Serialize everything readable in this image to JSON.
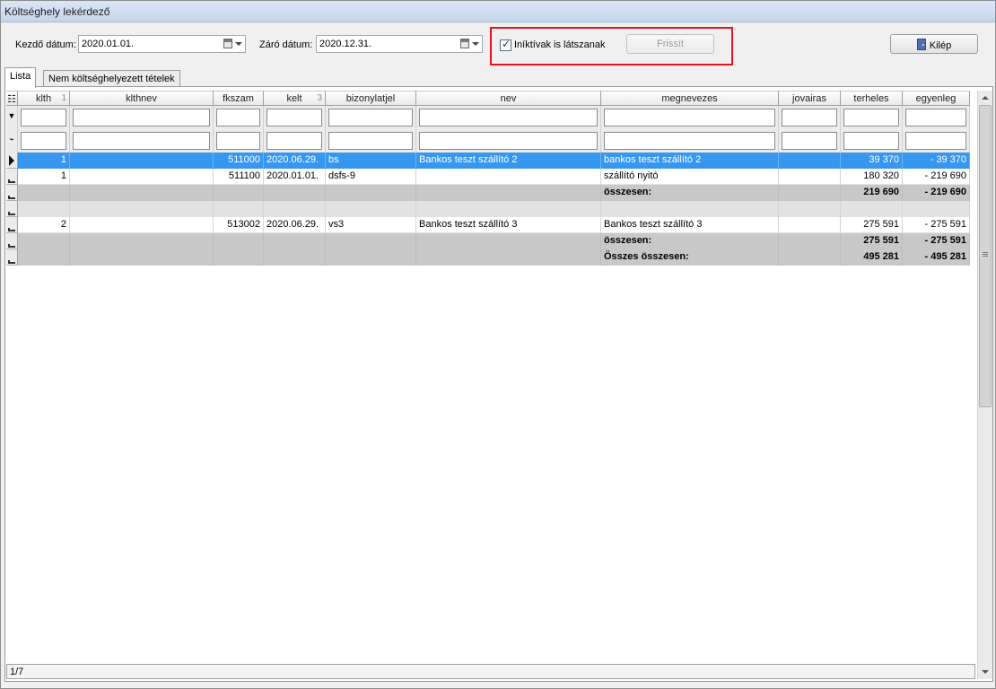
{
  "window": {
    "title": "Költséghely lekérdező"
  },
  "toolbar": {
    "start_label": "Kezdő dátum:",
    "start_value": "2020.01.01.",
    "end_label": "Záró dátum:",
    "end_value": "2020.12.31.",
    "inactive_label": "Iníktívak is látszanak",
    "inactive_checked": true,
    "refresh_label": "Frissít",
    "exit_label": "Kilép",
    "highlight_color": "#e8141d"
  },
  "tabs": [
    {
      "label": "Lista",
      "active": true
    },
    {
      "label": "Nem költséghelyezett tételek",
      "active": false
    }
  ],
  "grid": {
    "columns": [
      {
        "label": "klth",
        "sort": "1"
      },
      {
        "label": "klthnev",
        "sort": ""
      },
      {
        "label": "fkszam",
        "sort": ""
      },
      {
        "label": "kelt",
        "sort": "3"
      },
      {
        "label": "bizonylatjel",
        "sort": ""
      },
      {
        "label": "nev",
        "sort": ""
      },
      {
        "label": "megnevezes",
        "sort": ""
      },
      {
        "label": "jovairas",
        "sort": ""
      },
      {
        "label": "terheles",
        "sort": ""
      },
      {
        "label": "egyenleg",
        "sort": ""
      }
    ],
    "rows": [
      {
        "type": "selected",
        "klth": "1",
        "klthnev": "",
        "fkszam": "511000",
        "kelt": "2020.06.29.",
        "bizonylatjel": "bs",
        "nev": "Bankos teszt szállító 2",
        "megnevezes": "bankos teszt szállító 2",
        "jovairas": "",
        "terheles": "39 370",
        "egyenleg": "- 39 370"
      },
      {
        "type": "normal",
        "klth": "1",
        "klthnev": "",
        "fkszam": "511100",
        "kelt": "2020.01.01.",
        "bizonylatjel": "dsfs-9",
        "nev": "",
        "megnevezes": "szállító nyitó",
        "jovairas": "",
        "terheles": "180 320",
        "egyenleg": "- 219 690"
      },
      {
        "type": "total",
        "klth": "",
        "klthnev": "",
        "fkszam": "",
        "kelt": "",
        "bizonylatjel": "",
        "nev": "",
        "megnevezes": "összesen:",
        "jovairas": "",
        "terheles": "219 690",
        "egyenleg": "- 219 690"
      },
      {
        "type": "blank",
        "klth": "",
        "klthnev": "",
        "fkszam": "",
        "kelt": "",
        "bizonylatjel": "",
        "nev": "",
        "megnevezes": "",
        "jovairas": "",
        "terheles": "",
        "egyenleg": ""
      },
      {
        "type": "normal",
        "klth": "2",
        "klthnev": "",
        "fkszam": "513002",
        "kelt": "2020.06.29.",
        "bizonylatjel": "vs3",
        "nev": "Bankos teszt szállító 3",
        "megnevezes": "Bankos teszt szállító 3",
        "jovairas": "",
        "terheles": "275 591",
        "egyenleg": "- 275 591"
      },
      {
        "type": "total",
        "klth": "",
        "klthnev": "",
        "fkszam": "",
        "kelt": "",
        "bizonylatjel": "",
        "nev": "",
        "megnevezes": "összesen:",
        "jovairas": "",
        "terheles": "275 591",
        "egyenleg": "- 275 591"
      },
      {
        "type": "total",
        "klth": "",
        "klthnev": "",
        "fkszam": "",
        "kelt": "",
        "bizonylatjel": "",
        "nev": "",
        "megnevezes": "Összes összesen:",
        "jovairas": "",
        "terheles": "495 281",
        "egyenleg": "- 495 281"
      }
    ]
  },
  "status": {
    "record_position": "1/7"
  }
}
